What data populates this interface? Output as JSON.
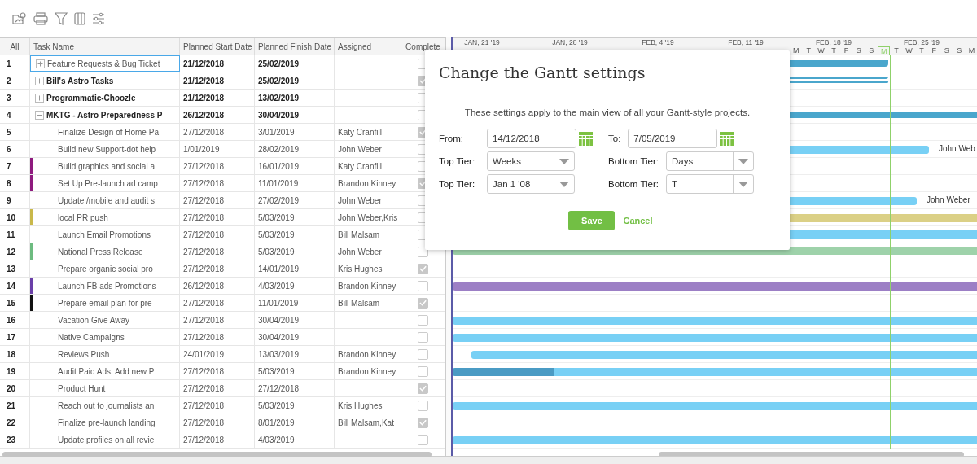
{
  "columns": [
    {
      "label": "All"
    },
    {
      "label": "Task Name"
    },
    {
      "label": "Planned Start Date"
    },
    {
      "label": "Planned Finish Date"
    },
    {
      "label": "Assigned"
    },
    {
      "label": "Complete"
    }
  ],
  "rows": [
    {
      "num": "1",
      "kind": "group",
      "expanded": false,
      "selected": true,
      "name": "Feature Requests & Bug Ticket",
      "start": "21/12/2018",
      "finish": "25/02/2019",
      "complete": false
    },
    {
      "num": "2",
      "kind": "group",
      "expanded": false,
      "selected": false,
      "name": "Bill's Astro Tasks",
      "start": "21/12/2018",
      "finish": "25/02/2019",
      "complete": true
    },
    {
      "num": "3",
      "kind": "group",
      "expanded": false,
      "selected": false,
      "name": "Programmatic-Choozle",
      "start": "21/12/2018",
      "finish": "13/02/2019",
      "complete": false
    },
    {
      "num": "4",
      "kind": "group",
      "expanded": true,
      "selected": false,
      "name": "MKTG - Astro Preparedness P",
      "start": "26/12/2018",
      "finish": "30/04/2019",
      "complete": false
    },
    {
      "num": "5",
      "kind": "task",
      "selected": false,
      "name": "Finalize Design of Home Pa",
      "start": "27/12/2018",
      "finish": "3/01/2019",
      "assigned": "Katy Cranfill",
      "complete": true
    },
    {
      "num": "6",
      "kind": "task",
      "selected": false,
      "name": "Build new Support-dot help",
      "start": "1/01/2019",
      "finish": "28/02/2019",
      "assigned": "John Weber",
      "complete": false,
      "bar_label": "John Web"
    },
    {
      "num": "7",
      "kind": "task",
      "selected": false,
      "color": "#8e1a7e",
      "name": "Build graphics and social a",
      "start": "27/12/2018",
      "finish": "16/01/2019",
      "assigned": "Katy Cranfill",
      "complete": false
    },
    {
      "num": "8",
      "kind": "task",
      "selected": false,
      "color": "#8e1a7e",
      "name": "Set Up Pre-launch ad camp",
      "start": "27/12/2018",
      "finish": "11/01/2019",
      "assigned": "Brandon Kinney",
      "complete": true
    },
    {
      "num": "9",
      "kind": "task",
      "selected": false,
      "name": "Update /mobile and audit s",
      "start": "27/12/2018",
      "finish": "27/02/2019",
      "assigned": "John Weber",
      "complete": false,
      "bar_label": "John Weber"
    },
    {
      "num": "10",
      "kind": "task",
      "selected": false,
      "color": "#c9b84a",
      "name": "local PR push",
      "start": "27/12/2018",
      "finish": "5/03/2019",
      "assigned": "John Weber,Kris",
      "complete": false
    },
    {
      "num": "11",
      "kind": "task",
      "selected": false,
      "name": "Launch Email Promotions",
      "start": "27/12/2018",
      "finish": "5/03/2019",
      "assigned": "Bill Malsam",
      "complete": false
    },
    {
      "num": "12",
      "kind": "task",
      "selected": false,
      "color": "#6dbb80",
      "name": "National Press Release",
      "start": "27/12/2018",
      "finish": "5/03/2019",
      "assigned": "John Weber",
      "complete": false
    },
    {
      "num": "13",
      "kind": "task",
      "selected": false,
      "name": "Prepare organic social pro",
      "start": "27/12/2018",
      "finish": "14/01/2019",
      "assigned": "Kris Hughes",
      "complete": true
    },
    {
      "num": "14",
      "kind": "task",
      "selected": false,
      "color": "#6a3fa8",
      "name": "Launch FB ads Promotions",
      "start": "26/12/2018",
      "finish": "4/03/2019",
      "assigned": "Brandon Kinney",
      "complete": false
    },
    {
      "num": "15",
      "kind": "task",
      "selected": false,
      "color": "#111111",
      "name": "Prepare email plan for pre-",
      "start": "27/12/2018",
      "finish": "11/01/2019",
      "assigned": "Bill Malsam",
      "complete": true
    },
    {
      "num": "16",
      "kind": "task",
      "selected": false,
      "name": "Vacation Give Away",
      "start": "27/12/2018",
      "finish": "30/04/2019",
      "complete": false
    },
    {
      "num": "17",
      "kind": "task",
      "selected": false,
      "name": "Native Campaigns",
      "start": "27/12/2018",
      "finish": "30/04/2019",
      "complete": false
    },
    {
      "num": "18",
      "kind": "task",
      "selected": false,
      "name": "Reviews Push",
      "start": "24/01/2019",
      "finish": "13/03/2019",
      "assigned": "Brandon Kinney",
      "complete": false
    },
    {
      "num": "19",
      "kind": "task",
      "selected": false,
      "name": "Audit Paid Ads, Add new P",
      "start": "27/12/2018",
      "finish": "5/03/2019",
      "assigned": "Brandon Kinney",
      "complete": false
    },
    {
      "num": "20",
      "kind": "task",
      "selected": false,
      "name": "Product Hunt",
      "start": "27/12/2018",
      "finish": "27/12/2018",
      "complete": true
    },
    {
      "num": "21",
      "kind": "task",
      "selected": false,
      "name": "Reach out to journalists an",
      "start": "27/12/2018",
      "finish": "5/03/2019",
      "assigned": "Kris Hughes",
      "complete": false
    },
    {
      "num": "22",
      "kind": "task",
      "selected": false,
      "name": "Finalize pre-launch landing",
      "start": "27/12/2018",
      "finish": "8/01/2019",
      "assigned": "Bill Malsam,Kat",
      "complete": true
    },
    {
      "num": "23",
      "kind": "task",
      "selected": false,
      "name": "Update profiles on all revie",
      "start": "27/12/2018",
      "finish": "4/03/2019",
      "complete": false
    }
  ],
  "timeline": {
    "weeks": [
      "JAN, 21 '19",
      "JAN, 28 '19",
      "FEB, 4 '19",
      "FEB, 11 '19",
      "FEB, 18 '19",
      "FEB, 25 '19"
    ],
    "days": [
      {
        "label": "M",
        "today": false
      },
      {
        "label": "T",
        "today": false
      },
      {
        "label": "W",
        "today": false
      },
      {
        "label": "T",
        "today": false
      },
      {
        "label": "F",
        "today": false
      },
      {
        "label": "S",
        "today": false
      },
      {
        "label": "S",
        "today": false
      },
      {
        "label": "M",
        "today": true
      },
      {
        "label": "T",
        "today": false
      },
      {
        "label": "W",
        "today": false
      },
      {
        "label": "T",
        "today": false
      },
      {
        "label": "F",
        "today": false
      },
      {
        "label": "S",
        "today": false
      },
      {
        "label": "S",
        "today": false
      },
      {
        "label": "M",
        "today": false
      }
    ]
  },
  "dialog": {
    "title": "Change the Gantt settings",
    "description": "These settings apply to the main view of all your Gantt-style projects.",
    "fields": [
      {
        "kind": "date",
        "label": "From:",
        "value": "14/12/2018"
      },
      {
        "kind": "date",
        "label": "To:",
        "value": "7/05/2019"
      },
      {
        "kind": "select",
        "label": "Top Tier:",
        "value": "Weeks"
      },
      {
        "kind": "select",
        "label": "Bottom Tier:",
        "value": "Days"
      },
      {
        "kind": "select",
        "label": "Top Tier:",
        "value": "Jan 1 '08"
      },
      {
        "kind": "select",
        "label": "Bottom Tier:",
        "value": "T"
      }
    ],
    "save": "Save",
    "cancel": "Cancel"
  }
}
